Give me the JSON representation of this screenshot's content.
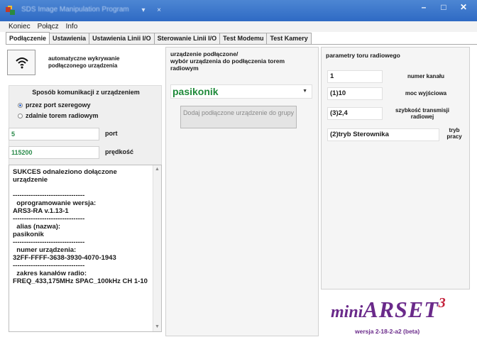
{
  "window": {
    "title": "SDS Image Manipulation Program",
    "quick_access_icon": "pin-icon",
    "controls": {
      "minimize": "–",
      "maximize": "□",
      "close": "✕"
    }
  },
  "menu": [
    "Koniec",
    "Połącz",
    "Info"
  ],
  "tabs": [
    {
      "label": "Podłączenie",
      "active": true
    },
    {
      "label": "Ustawienia",
      "active": false
    },
    {
      "label": "Ustawienia Linii I/O",
      "active": false
    },
    {
      "label": "Sterowanie Linii I/O",
      "active": false
    },
    {
      "label": "Test Modemu",
      "active": false
    },
    {
      "label": "Test Kamery",
      "active": false
    }
  ],
  "connection": {
    "auto_detect_label": "automatyczne wykrywanie podłączonego urządzenia",
    "wifi_icon": "wifi-icon",
    "comm_title": "Sposób komunikacji z urządzeniem",
    "radio_serial": "przez port szeregowy",
    "radio_remote": "zdalnie torem radiowym",
    "selected": "przez port szeregowy",
    "port_value": "5",
    "port_label": "port",
    "speed_value": "115200",
    "speed_label": "prędkość",
    "log": "SUKCES odnaleziono dołączone urządzenie\n\n--------------------------------\n  oprogramowanie wersja:\nARS3-RA v.1.13-1\n--------------------------------\n  alias (nazwa):\npasikonik\n--------------------------------\n  numer urządzenia:\n32FF-FFFF-3638-3930-4070-1943\n--------------------------------\n  zakres kanałów radio:\nFREQ_433,175MHz SPAC_100kHz CH 1-10"
  },
  "device": {
    "label": "urządzenie podłączone/\nwybór urządzenia do podłączenia torem radiowym",
    "selected": "pasikonik",
    "add_button": "Dodaj podłączone urządzenie do grupy"
  },
  "radio_params": {
    "title": "parametry toru radiowego",
    "channel_value": "1",
    "channel_label": "numer kanału",
    "power_value": "(1)10",
    "power_label": "moc wyjściowa",
    "rate_value": "(3)2,4",
    "rate_label": "szybkość transmisji radiowej",
    "mode_value": "(2)tryb Sterownika",
    "mode_label": "tryb pracy"
  },
  "brand": {
    "mini": "mini",
    "arset": "ARSET",
    "sup": "3",
    "version": "wersja 2-18-2-a2 (beta)",
    "colors": {
      "primary": "#6a2a8a",
      "accent": "#c4203a"
    }
  },
  "colors": {
    "titlebar": "#3a74c8",
    "value_green": "#2a8a4a",
    "panel_bg": "#f5f5f5"
  }
}
